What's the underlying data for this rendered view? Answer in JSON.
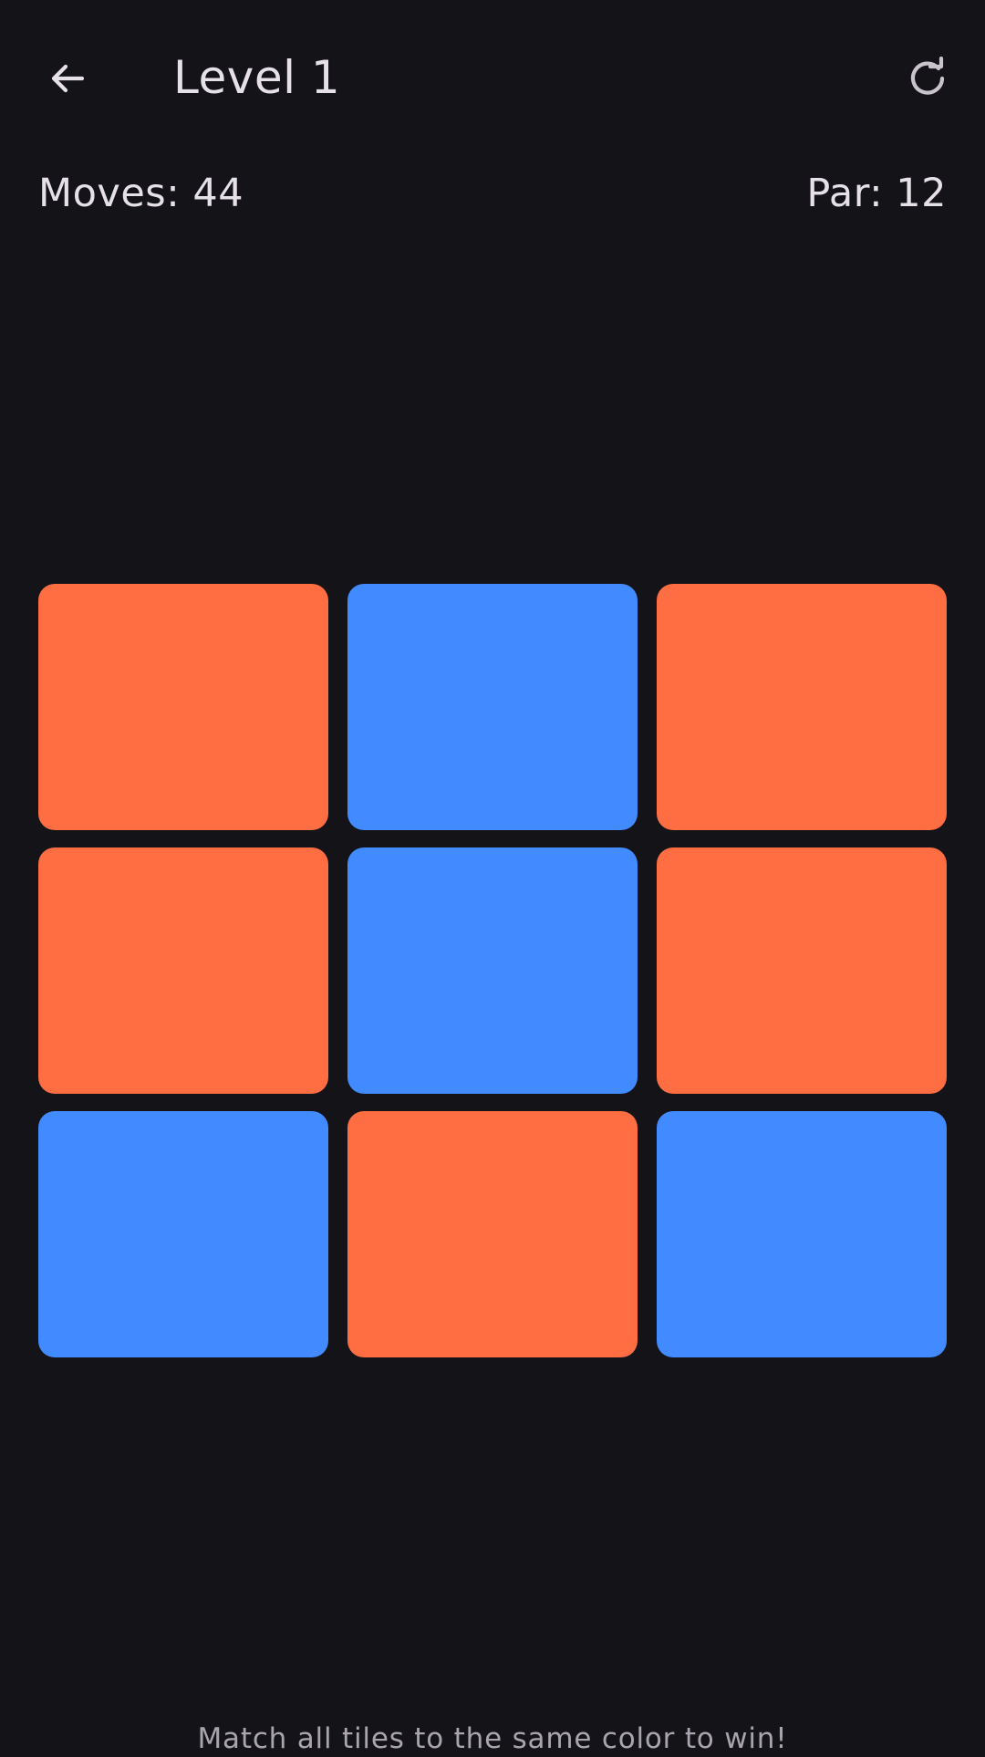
{
  "header": {
    "title": "Level 1",
    "back_icon": "arrow-left-icon",
    "reset_icon": "refresh-icon"
  },
  "stats": {
    "moves_label": "Moves: 44",
    "moves": 44,
    "par_label": "Par: 12",
    "par": 12
  },
  "board": {
    "rows": 3,
    "cols": 3,
    "colors": {
      "orange": "#ff6d42",
      "blue": "#428aff"
    },
    "tiles": [
      [
        "orange",
        "blue",
        "orange"
      ],
      [
        "orange",
        "blue",
        "orange"
      ],
      [
        "blue",
        "orange",
        "blue"
      ]
    ]
  },
  "footer": {
    "hint": "Match all tiles to the same color to win!"
  },
  "theme": {
    "background": "#141317",
    "text": "#e6e1e9",
    "muted_text": "#a9a4ad"
  }
}
